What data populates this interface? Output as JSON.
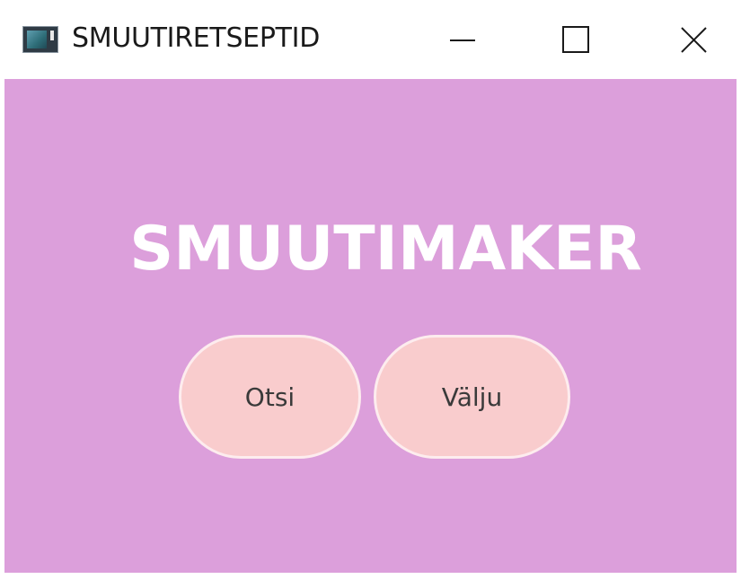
{
  "window": {
    "title": "SMUUTIRETSEPTID",
    "controls": {
      "minimize_icon": "minimize-icon",
      "maximize_icon": "maximize-icon",
      "close_icon": "close-icon"
    }
  },
  "main": {
    "heading": "SMUUTIMAKER",
    "buttons": {
      "search_label": "Otsi",
      "choose_label": "Välju"
    }
  },
  "colors": {
    "background": "#dc9fdb",
    "button_fill": "#f9cccd",
    "button_border": "#fdecee",
    "heading": "#ffffff"
  }
}
